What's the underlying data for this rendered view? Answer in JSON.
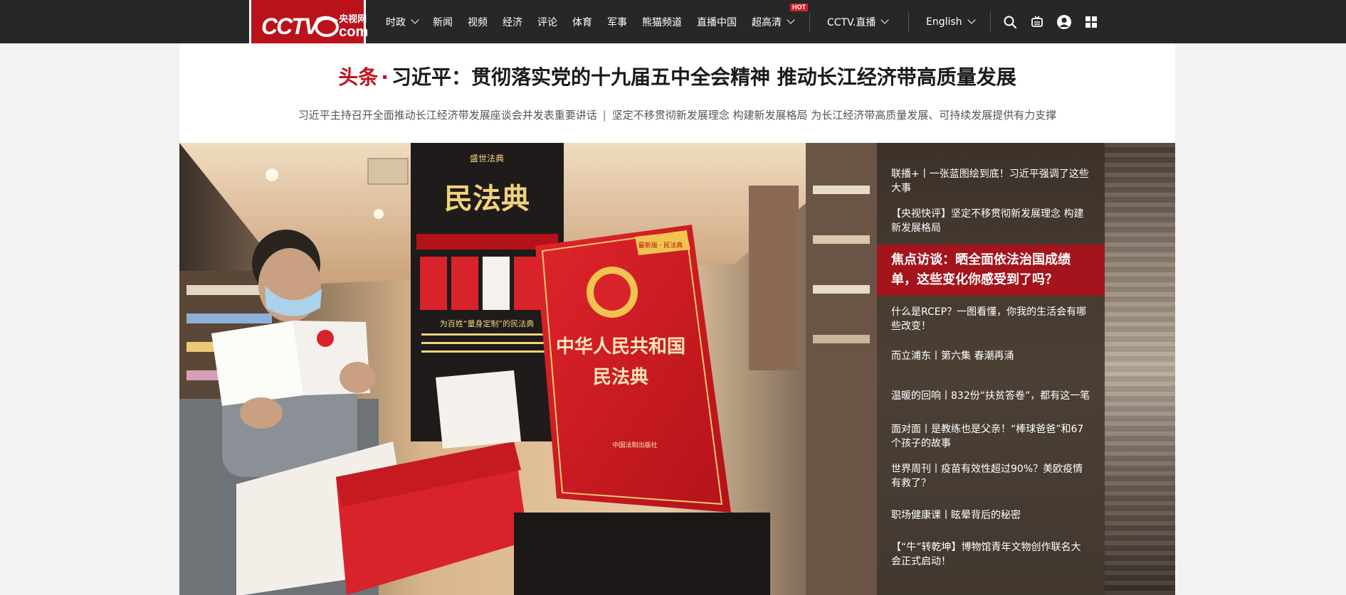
{
  "brand": {
    "logo_text": "CCTV",
    "logo_cn": "央视网",
    "logo_com": "com",
    "accent": "#b9121b"
  },
  "nav": {
    "items": [
      {
        "label": "时政",
        "dropdown": true
      },
      {
        "label": "新闻"
      },
      {
        "label": "视频"
      },
      {
        "label": "经济"
      },
      {
        "label": "评论"
      },
      {
        "label": "体育"
      },
      {
        "label": "军事"
      },
      {
        "label": "熊猫频道"
      },
      {
        "label": "直播中国"
      },
      {
        "label": "超高清",
        "dropdown": true,
        "badge": "HOT"
      }
    ],
    "live_label": "CCTV.直播",
    "lang_label": "English",
    "icons": [
      "search-icon",
      "tv-icon",
      "user-icon",
      "apps-icon"
    ]
  },
  "headline": {
    "tag": "头条",
    "dot": "·",
    "title": "习近平：贯彻落实党的十九届五中全会精神 推动长江经济带高质量发展",
    "sub_1": "习近平主持召开全面推动长江经济带发展座谈会并发表重要讲话",
    "sub_sep": "|",
    "sub_2": "坚定不移贯彻新发展理念 构建新发展格局 为长江经济带高质量发展、可持续发展提供有力支撑"
  },
  "hero": {
    "image_alt": "民法典 photo",
    "poster_title": "民法典",
    "poster_top": "盛世法典",
    "poster_tagline": "为百姓“量身定制”的民法典",
    "book_title_1": "中华人民共和国",
    "book_title_2": "民法典",
    "book_tag": "最新版 · 民法典",
    "publisher": "中国法制出版社"
  },
  "side_news": [
    {
      "text": "联播+丨一张蓝图绘到底！习近平强调了这些大事",
      "active": false
    },
    {
      "text": "【央视快评】坚定不移贯彻新发展理念 构建新发展格局",
      "active": false
    },
    {
      "text": "焦点访谈：晒全面依法治国成绩单，这些变化你感受到了吗？",
      "active": true
    },
    {
      "text": "什么是RCEP？一图看懂，你我的生活会有哪些改变！",
      "active": false
    },
    {
      "text": "而立浦东丨第六集 春潮再涌",
      "active": false
    },
    {
      "text": "温暖的回响丨832份“扶贫答卷”，都有这一笔",
      "active": false
    },
    {
      "text": "面对面丨是教练也是父亲！“棒球爸爸”和67个孩子的故事",
      "active": false
    },
    {
      "text": "世界周刊丨疫苗有效性超过90%？美欧疫情有救了？",
      "active": false
    },
    {
      "text": "职场健康课丨眩晕背后的秘密",
      "active": false
    },
    {
      "text": "【“牛”转乾坤】博物馆青年文物创作联名大会正式启动！",
      "active": false
    }
  ]
}
